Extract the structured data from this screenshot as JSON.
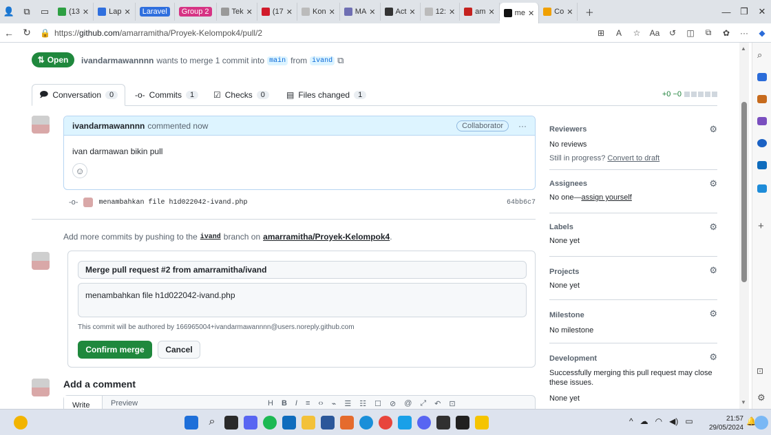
{
  "browser": {
    "tabs": [
      {
        "label": "(13",
        "color": "#2ea043"
      },
      {
        "label": "Lap",
        "color": "#2f6fde"
      },
      {
        "label": "Laravel",
        "color": "#2f6fde",
        "group": true
      },
      {
        "label": "Group 2",
        "color": "#d63384",
        "group": true
      },
      {
        "label": "Tek",
        "color": "#999999"
      },
      {
        "label": "(17",
        "color": "#d11a2a"
      },
      {
        "label": "Kon",
        "color": "#bbbbbb"
      },
      {
        "label": "MA",
        "color": "#6f6fb3"
      },
      {
        "label": "Act",
        "color": "#333333"
      },
      {
        "label": "12:",
        "color": "#bbbbbb"
      },
      {
        "label": "am",
        "color": "#c5221f"
      },
      {
        "label": "me",
        "color": "#111111",
        "active": true
      },
      {
        "label": "Co",
        "color": "#f0a000"
      }
    ],
    "url_prefix": "https://",
    "url_host": "github.com",
    "url_path": "/amarramitha/Proyek-Kelompok4/pull/2"
  },
  "pr": {
    "state": "Open",
    "author": "ivandarmawannnn",
    "merge_text": "wants to merge 1 commit into",
    "base_branch": "main",
    "from_text": "from",
    "head_branch": "ivand",
    "tabs": [
      {
        "label": "Conversation",
        "count": "0"
      },
      {
        "label": "Commits",
        "count": "1"
      },
      {
        "label": "Checks",
        "count": "0"
      },
      {
        "label": "Files changed",
        "count": "1"
      }
    ],
    "diffstat": "+0 −0"
  },
  "comment": {
    "author": "ivandarmawannnn",
    "time_text": "commented now",
    "badge": "Collaborator",
    "more": "···",
    "body": "ivan darmawan bikin pull"
  },
  "commit": {
    "message": "menambahkan file h1d022042-ivand.php",
    "sha": "64bb6c7"
  },
  "push_hint": {
    "prefix": "Add more commits by pushing to the",
    "branch": "ivand",
    "middle": "branch on",
    "repo": "amarramitha/Proyek-Kelompok4",
    "suffix": "."
  },
  "merge": {
    "title_value": "Merge pull request #2 from amarramitha/ivand",
    "body_value": "menambahkan file h1d022042-ivand.php",
    "author_note": "This commit will be authored by 166965004+ivandarmawannnn@users.noreply.github.com",
    "confirm_label": "Confirm merge",
    "cancel_label": "Cancel"
  },
  "new_comment": {
    "heading": "Add a comment",
    "tab_write": "Write",
    "tab_preview": "Preview"
  },
  "sidebar": {
    "reviewers": {
      "title": "Reviewers",
      "value": "No reviews",
      "hint": "Still in progress?",
      "hint_link": "Convert to draft"
    },
    "assignees": {
      "title": "Assignees",
      "value": "No one—",
      "link": "assign yourself"
    },
    "labels": {
      "title": "Labels",
      "value": "None yet"
    },
    "projects": {
      "title": "Projects",
      "value": "None yet"
    },
    "milestone": {
      "title": "Milestone",
      "value": "No milestone"
    },
    "development": {
      "title": "Development",
      "value": "Successfully merging this pull request may close these issues.",
      "extra": "None yet"
    }
  },
  "taskbar": {
    "time": "21:57",
    "date": "29/05/2024"
  }
}
